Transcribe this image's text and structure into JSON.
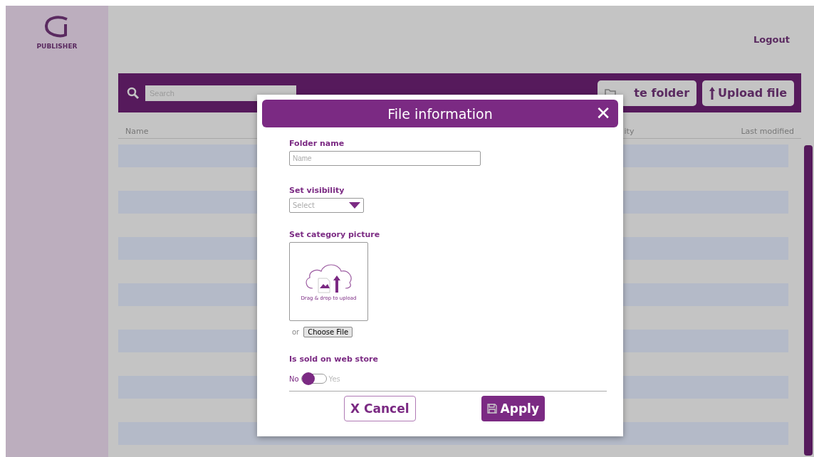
{
  "sidebar": {
    "logo_text": "PUBLISHER"
  },
  "header": {
    "logout": "Logout"
  },
  "toolbar": {
    "search": {
      "placeholder": "Search"
    },
    "buttons": [
      {
        "kind": "folder",
        "label": "te folder"
      },
      {
        "kind": "upload",
        "label": "Upload file"
      }
    ]
  },
  "table": {
    "columns": [
      "Name",
      "ity",
      "Last modified"
    ]
  },
  "dialog": {
    "title": "File information",
    "close": "✕",
    "folder_name": {
      "label": "Folder name",
      "placeholder": "Name"
    },
    "visibility": {
      "label": "Set visibility",
      "placeholder": "Select"
    },
    "picture": {
      "label": "Set category picture",
      "drop_text": "Drag & drop to upload",
      "or": "or",
      "choose": "Choose File"
    },
    "web_store": {
      "label": "Is sold on web store",
      "off_label": "No",
      "on_label": "Yes",
      "on": false
    },
    "buttons": [
      {
        "kind": "cancel",
        "label": "X Cancel"
      },
      {
        "kind": "apply",
        "label": "Apply"
      }
    ]
  }
}
